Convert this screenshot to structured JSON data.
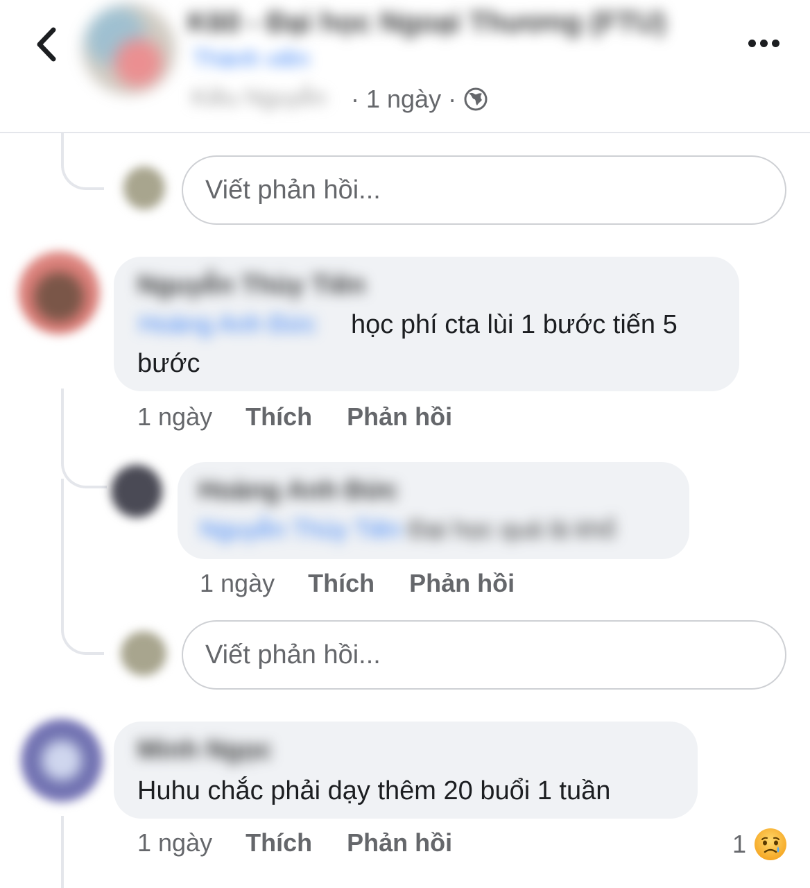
{
  "header": {
    "group_name": "K60 - Đại học Ngoại Thương (FTU)",
    "group_subtitle": "Thành viên",
    "poster_name": "Kiều Nguyễn",
    "time": "· 1 ngày ·",
    "privacy_icon": "globe-icon"
  },
  "thread": {
    "reply_placeholder": "Viết phản hồi...",
    "comments": [
      {
        "author": "Nguyễn Thùy Tiên",
        "tag": "Hoàng Anh Đức",
        "text": "học phí cta lùi 1 bước tiến 5",
        "text_wrap": "bước",
        "time": "1 ngày",
        "like_label": "Thích",
        "reply_label": "Phản hồi"
      },
      {
        "author": "Hoàng Anh Đức",
        "tag": "Nguyễn Thùy Tiên",
        "text": "Đại học quá là khổ",
        "time": "1 ngày",
        "like_label": "Thích",
        "reply_label": "Phản hồi"
      },
      {
        "author": "Minh Ngọc",
        "text": "Huhu chắc phải dạy thêm 20 buổi 1 tuần",
        "time": "1 ngày",
        "like_label": "Thích",
        "reply_label": "Phản hồi",
        "reaction_count": "1",
        "reaction_icon": "sad-emoji-icon"
      }
    ]
  }
}
